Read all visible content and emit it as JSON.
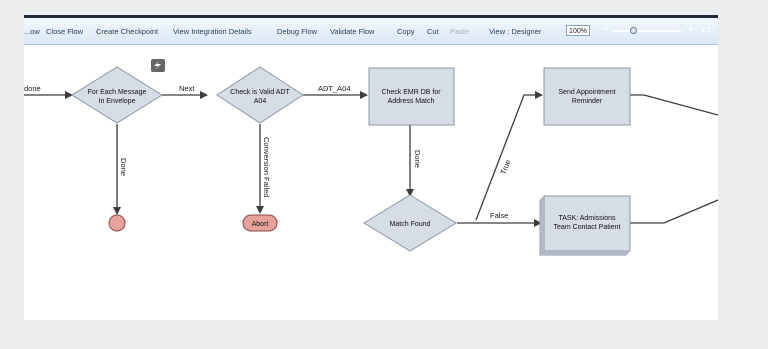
{
  "toolbar": {
    "items": [
      "...ow",
      "Close Flow",
      "Create Checkpoint",
      "View Integration Details",
      "Debug Flow",
      "Validate Flow",
      "Copy",
      "Cut",
      "Paste",
      "View : Designer"
    ],
    "zoom_value": "100%",
    "zoom_minus": "−",
    "zoom_plus": "+",
    "fit_label": "1:1"
  },
  "flow": {
    "edges": {
      "done_in": "done",
      "next": "Next",
      "adt": "ADT_A04",
      "done_loop": "Done",
      "conversion_failed": "Conversion Failed",
      "done_emr": "Done",
      "true_label": "True",
      "false_label": "False"
    },
    "nodes": {
      "for_each": [
        "For Each Message",
        "In Envelope"
      ],
      "check_valid": [
        "Check is Valid ADT",
        "A04"
      ],
      "check_emr": [
        "Check EMR DB for",
        "Address Match"
      ],
      "send_appt": [
        "Send Appointment",
        "Reminder"
      ],
      "abort": "Abort",
      "match_found": "Match Found",
      "task_admissions": [
        "TASK: Admissions",
        "Team Contact Patient"
      ]
    }
  }
}
